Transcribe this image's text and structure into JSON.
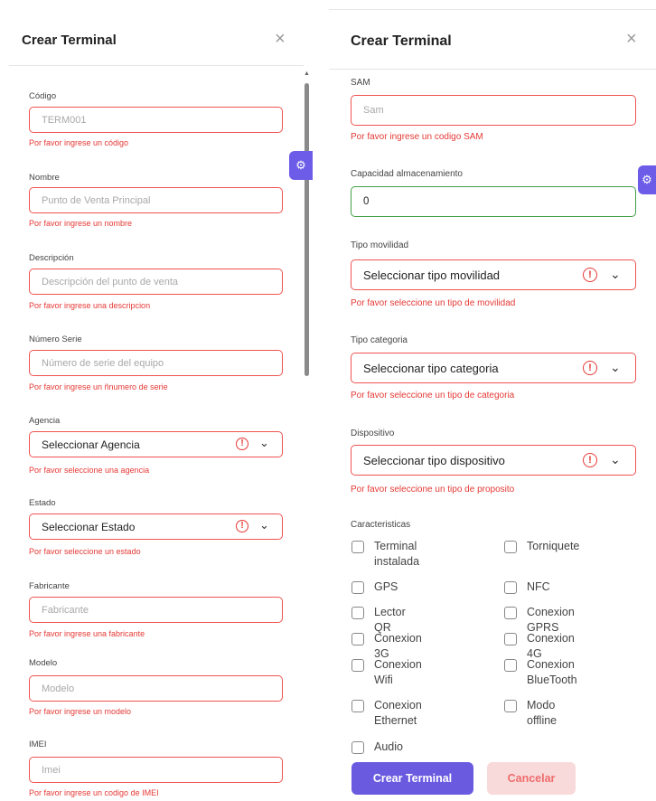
{
  "left": {
    "title": "Crear Terminal",
    "close": "×",
    "fields": [
      {
        "label": "Código",
        "placeholder": "TERM001",
        "error": "Por favor ingrese un código"
      },
      {
        "label": "Nombre",
        "placeholder": "Punto de Venta Principal",
        "error": "Por favor ingrese un nombre"
      },
      {
        "label": "Descripción",
        "placeholder": "Descripción del punto de venta",
        "error": "Por favor ingrese una descripcion"
      },
      {
        "label": "Número Serie",
        "placeholder": "Número de serie del equipo",
        "error": "Por favor ingrese un ñnumero de serie"
      },
      {
        "label": "Agencia",
        "selected": "Seleccionar Agencia",
        "error": "Por favor seleccione una agencia"
      },
      {
        "label": "Estado",
        "selected": "Seleccionar Estado",
        "error": "Por favor seleccione un estado"
      },
      {
        "label": "Fabricante",
        "placeholder": "Fabricante",
        "error": "Por favor ingrese una fabricante"
      },
      {
        "label": "Modelo",
        "placeholder": "Modelo",
        "error": "Por favor ingrese un modelo"
      },
      {
        "label": "IMEI",
        "placeholder": "Imei",
        "error": "Por favor ingrese un codigo de IMEI"
      }
    ]
  },
  "right": {
    "title": "Crear Terminal",
    "close": "×",
    "sam": {
      "label": "SAM",
      "placeholder": "Sam",
      "error": "Por favor ingrese un codigo SAM"
    },
    "capacidad": {
      "label": "Capacidad almacenamiento",
      "value": "0"
    },
    "movilidad": {
      "label": "Tipo movilidad",
      "selected": "Seleccionar tipo movilidad",
      "error": "Por favor seleccione un tipo de movilidad"
    },
    "categoria": {
      "label": "Tipo categoria",
      "selected": "Seleccionar tipo categoria",
      "error": "Por favor seleccione un tipo de categoria"
    },
    "dispositivo": {
      "label": "Dispositivo",
      "selected": "Seleccionar tipo dispositivo",
      "error": "Por favor seleccione un tipo de proposito"
    },
    "caracteristicas": {
      "label": "Caracteristicas",
      "items": [
        "Terminal\ninstalada",
        "Torniquete",
        "GPS",
        "NFC",
        "Lector QR",
        "Conexion GPRS",
        "Conexion 3G",
        "Conexion 4G",
        "Conexion Wifi",
        "Conexion\nBlueTooth",
        "Conexion\nEthernet",
        "Modo offline",
        "Audio"
      ]
    },
    "buttons": {
      "create": "Crear Terminal",
      "cancel": "Cancelar"
    }
  },
  "icons": {
    "warn_glyph": "!",
    "chevron_glyph": "⌄",
    "gear_glyph": "⚙"
  },
  "colors": {
    "accent": "#6a5ae0",
    "error": "#e53935",
    "success": "#43a047",
    "cancel_bg": "#f9dada"
  }
}
